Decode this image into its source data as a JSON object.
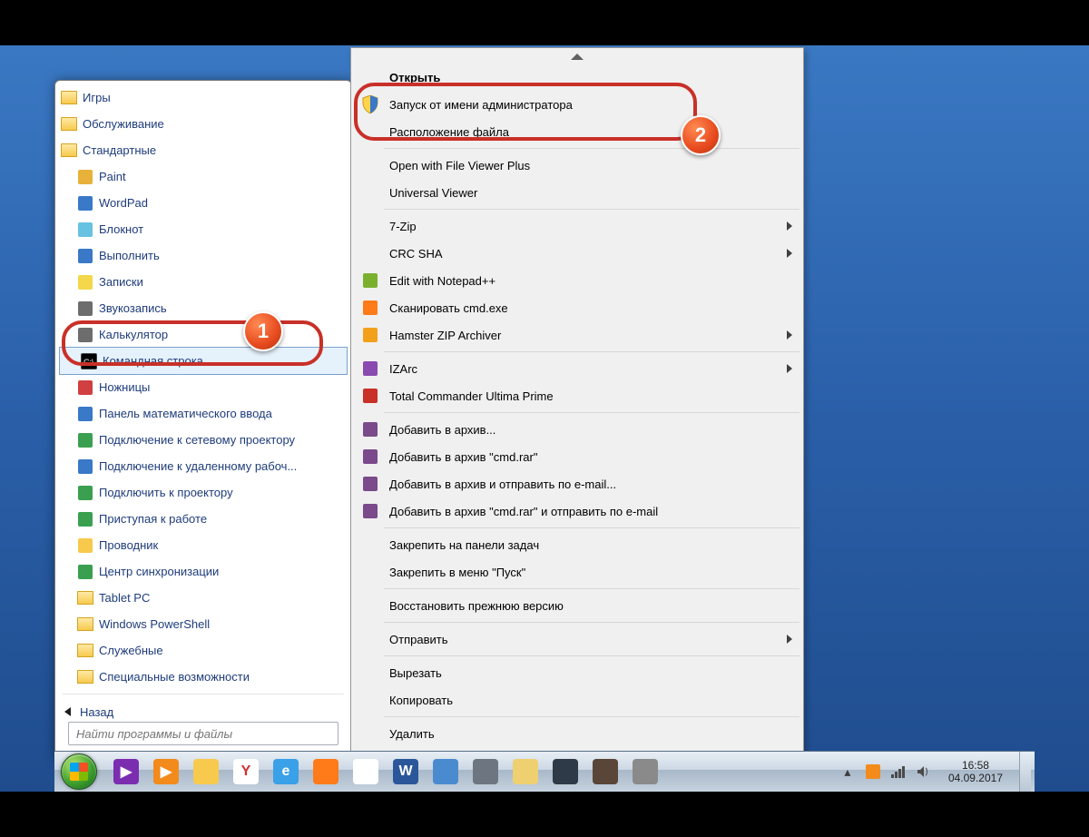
{
  "startmenu": {
    "folders_top": [
      {
        "label": "Игры"
      },
      {
        "label": "Обслуживание"
      },
      {
        "label": "Стандартные",
        "expanded": true
      }
    ],
    "accessories": [
      {
        "label": "Paint",
        "icon": "paint"
      },
      {
        "label": "WordPad",
        "icon": "wordpad"
      },
      {
        "label": "Блокнот",
        "icon": "notepad"
      },
      {
        "label": "Выполнить",
        "icon": "run"
      },
      {
        "label": "Записки",
        "icon": "sticky"
      },
      {
        "label": "Звукозапись",
        "icon": "sound"
      },
      {
        "label": "Калькулятор",
        "icon": "calc"
      },
      {
        "label": "Командная строка",
        "icon": "cmd",
        "selected": true
      },
      {
        "label": "Ножницы",
        "icon": "snip"
      },
      {
        "label": "Панель математического ввода",
        "icon": "math"
      },
      {
        "label": "Подключение к сетевому проектору",
        "icon": "netproj"
      },
      {
        "label": "Подключение к удаленному рабоч...",
        "icon": "rdp"
      },
      {
        "label": "Подключить к проектору",
        "icon": "proj"
      },
      {
        "label": "Приступая к работе",
        "icon": "getstarted"
      },
      {
        "label": "Проводник",
        "icon": "explorer"
      },
      {
        "label": "Центр синхронизации",
        "icon": "sync"
      }
    ],
    "folders_bottom": [
      {
        "label": "Tablet PC"
      },
      {
        "label": "Windows PowerShell"
      },
      {
        "label": "Служебные"
      },
      {
        "label": "Специальные возможности"
      }
    ],
    "back_label": "Назад",
    "search_placeholder": "Найти программы и файлы"
  },
  "contextmenu": {
    "items": [
      {
        "label": "Открыть",
        "bold": true
      },
      {
        "label": "Запуск от имени администратора",
        "icon": "shield",
        "highlight": true
      },
      {
        "label": "Расположение файла"
      },
      {
        "sep": true
      },
      {
        "label": "Open with File Viewer Plus"
      },
      {
        "label": "Universal Viewer"
      },
      {
        "sep": true
      },
      {
        "label": "7-Zip",
        "submenu": true
      },
      {
        "label": "CRC SHA",
        "submenu": true
      },
      {
        "label": "Edit with Notepad++",
        "icon": "npp"
      },
      {
        "label": "Сканировать cmd.exe",
        "icon": "avast"
      },
      {
        "label": "Hamster ZIP Archiver",
        "icon": "hamster",
        "submenu": true
      },
      {
        "sep": true
      },
      {
        "label": "IZArc",
        "icon": "izarc",
        "submenu": true
      },
      {
        "label": "Total Commander Ultima Prime",
        "icon": "tcup"
      },
      {
        "sep": true
      },
      {
        "label": "Добавить в архив...",
        "icon": "winrar"
      },
      {
        "label": "Добавить в архив \"cmd.rar\"",
        "icon": "winrar"
      },
      {
        "label": "Добавить в архив и отправить по e-mail...",
        "icon": "winrar"
      },
      {
        "label": "Добавить в архив \"cmd.rar\" и отправить по e-mail",
        "icon": "winrar"
      },
      {
        "sep": true
      },
      {
        "label": "Закрепить на панели задач"
      },
      {
        "label": "Закрепить в меню \"Пуск\""
      },
      {
        "sep": true
      },
      {
        "label": "Восстановить прежнюю версию"
      },
      {
        "sep": true
      },
      {
        "label": "Отправить",
        "submenu": true
      },
      {
        "sep": true
      },
      {
        "label": "Вырезать"
      },
      {
        "label": "Копировать"
      },
      {
        "sep": true
      },
      {
        "label": "Удалить"
      }
    ]
  },
  "badges": {
    "one": "1",
    "two": "2"
  },
  "taskbar": {
    "pinned": [
      {
        "name": "media-player",
        "color": "#7b2db0",
        "glyph": "▶"
      },
      {
        "name": "wmp",
        "color": "#f28a1c",
        "glyph": "▶"
      },
      {
        "name": "folder",
        "color": "#f7ca4d",
        "glyph": ""
      },
      {
        "name": "yandex",
        "color": "#ffffff",
        "glyph": "Y",
        "txt": "#d03030"
      },
      {
        "name": "ie",
        "color": "#3aa0e8",
        "glyph": "e"
      },
      {
        "name": "firefox",
        "color": "#ff7b1a",
        "glyph": ""
      },
      {
        "name": "chrome",
        "color": "#ffffff",
        "glyph": ""
      },
      {
        "name": "word",
        "color": "#2b579a",
        "glyph": "W"
      },
      {
        "name": "app1",
        "color": "#4a8bd0",
        "glyph": ""
      },
      {
        "name": "app2",
        "color": "#6d7680",
        "glyph": ""
      },
      {
        "name": "app3",
        "color": "#eed070",
        "glyph": ""
      },
      {
        "name": "app4",
        "color": "#2e3a48",
        "glyph": ""
      },
      {
        "name": "app5",
        "color": "#5a4638",
        "glyph": ""
      },
      {
        "name": "app6",
        "color": "#8a8a8a",
        "glyph": ""
      }
    ],
    "clock_time": "16:58",
    "clock_date": "04.09.2017"
  }
}
